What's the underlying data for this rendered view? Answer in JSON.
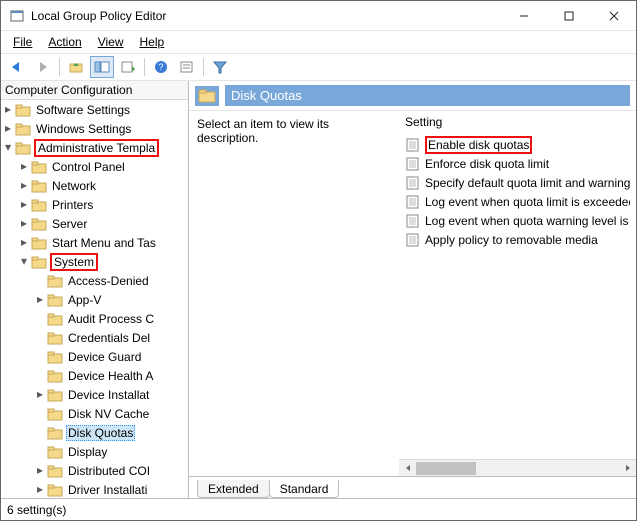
{
  "window": {
    "title": "Local Group Policy Editor"
  },
  "menubar": {
    "file": "File",
    "action": "Action",
    "view": "View",
    "help": "Help"
  },
  "tree": {
    "header": "Computer Configuration",
    "items": [
      {
        "indent": 0,
        "twisty": ">",
        "icon": "folder",
        "label": "Software Settings"
      },
      {
        "indent": 0,
        "twisty": ">",
        "icon": "folder",
        "label": "Windows Settings"
      },
      {
        "indent": 0,
        "twisty": "v",
        "icon": "folder",
        "label": "Administrative Templa",
        "highlight": true
      },
      {
        "indent": 1,
        "twisty": ">",
        "icon": "folder",
        "label": "Control Panel"
      },
      {
        "indent": 1,
        "twisty": ">",
        "icon": "folder",
        "label": "Network"
      },
      {
        "indent": 1,
        "twisty": ">",
        "icon": "folder",
        "label": "Printers"
      },
      {
        "indent": 1,
        "twisty": ">",
        "icon": "folder",
        "label": "Server"
      },
      {
        "indent": 1,
        "twisty": ">",
        "icon": "folder",
        "label": "Start Menu and Tas"
      },
      {
        "indent": 1,
        "twisty": "v",
        "icon": "folder",
        "label": "System",
        "highlight": true
      },
      {
        "indent": 2,
        "twisty": "",
        "icon": "folder",
        "label": "Access-Denied"
      },
      {
        "indent": 2,
        "twisty": ">",
        "icon": "folder",
        "label": "App-V"
      },
      {
        "indent": 2,
        "twisty": "",
        "icon": "folder",
        "label": "Audit Process C"
      },
      {
        "indent": 2,
        "twisty": "",
        "icon": "folder",
        "label": "Credentials Del"
      },
      {
        "indent": 2,
        "twisty": "",
        "icon": "folder",
        "label": "Device Guard"
      },
      {
        "indent": 2,
        "twisty": "",
        "icon": "folder",
        "label": "Device Health A"
      },
      {
        "indent": 2,
        "twisty": ">",
        "icon": "folder",
        "label": "Device Installat"
      },
      {
        "indent": 2,
        "twisty": "",
        "icon": "folder",
        "label": "Disk NV Cache"
      },
      {
        "indent": 2,
        "twisty": "",
        "icon": "folder",
        "label": "Disk Quotas",
        "highlight": true,
        "selected": true
      },
      {
        "indent": 2,
        "twisty": "",
        "icon": "folder",
        "label": "Display"
      },
      {
        "indent": 2,
        "twisty": ">",
        "icon": "folder",
        "label": "Distributed COI"
      },
      {
        "indent": 2,
        "twisty": ">",
        "icon": "folder",
        "label": "Driver Installati"
      }
    ]
  },
  "right": {
    "title": "Disk Quotas",
    "description": "Select an item to view its description.",
    "column": "Setting",
    "items": [
      {
        "label": "Enable disk quotas",
        "highlight": true
      },
      {
        "label": "Enforce disk quota limit"
      },
      {
        "label": "Specify default quota limit and warning leve"
      },
      {
        "label": "Log event when quota limit is exceeded"
      },
      {
        "label": "Log event when quota warning level is excee"
      },
      {
        "label": "Apply policy to removable media"
      }
    ]
  },
  "tabs": {
    "extended": "Extended",
    "standard": "Standard"
  },
  "statusbar": {
    "text": "6 setting(s)"
  }
}
